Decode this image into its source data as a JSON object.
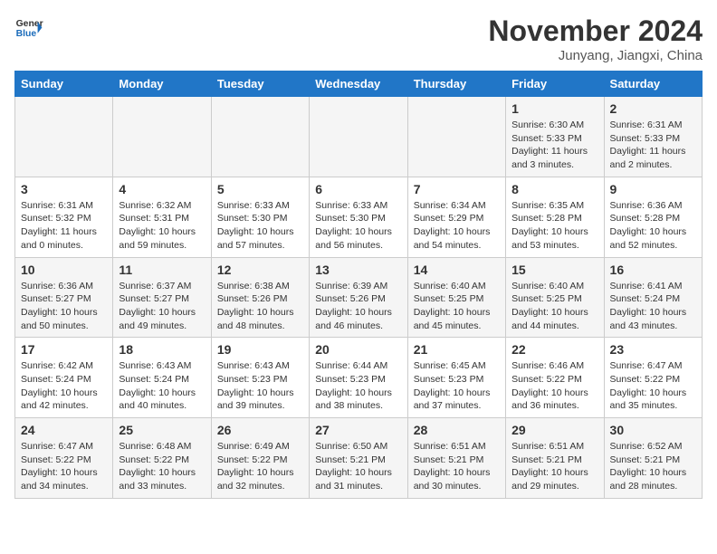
{
  "logo": {
    "general": "General",
    "blue": "Blue"
  },
  "title": "November 2024",
  "location": "Junyang, Jiangxi, China",
  "headers": [
    "Sunday",
    "Monday",
    "Tuesday",
    "Wednesday",
    "Thursday",
    "Friday",
    "Saturday"
  ],
  "weeks": [
    [
      {
        "day": "",
        "text": ""
      },
      {
        "day": "",
        "text": ""
      },
      {
        "day": "",
        "text": ""
      },
      {
        "day": "",
        "text": ""
      },
      {
        "day": "",
        "text": ""
      },
      {
        "day": "1",
        "text": "Sunrise: 6:30 AM\nSunset: 5:33 PM\nDaylight: 11 hours and 3 minutes."
      },
      {
        "day": "2",
        "text": "Sunrise: 6:31 AM\nSunset: 5:33 PM\nDaylight: 11 hours and 2 minutes."
      }
    ],
    [
      {
        "day": "3",
        "text": "Sunrise: 6:31 AM\nSunset: 5:32 PM\nDaylight: 11 hours and 0 minutes."
      },
      {
        "day": "4",
        "text": "Sunrise: 6:32 AM\nSunset: 5:31 PM\nDaylight: 10 hours and 59 minutes."
      },
      {
        "day": "5",
        "text": "Sunrise: 6:33 AM\nSunset: 5:30 PM\nDaylight: 10 hours and 57 minutes."
      },
      {
        "day": "6",
        "text": "Sunrise: 6:33 AM\nSunset: 5:30 PM\nDaylight: 10 hours and 56 minutes."
      },
      {
        "day": "7",
        "text": "Sunrise: 6:34 AM\nSunset: 5:29 PM\nDaylight: 10 hours and 54 minutes."
      },
      {
        "day": "8",
        "text": "Sunrise: 6:35 AM\nSunset: 5:28 PM\nDaylight: 10 hours and 53 minutes."
      },
      {
        "day": "9",
        "text": "Sunrise: 6:36 AM\nSunset: 5:28 PM\nDaylight: 10 hours and 52 minutes."
      }
    ],
    [
      {
        "day": "10",
        "text": "Sunrise: 6:36 AM\nSunset: 5:27 PM\nDaylight: 10 hours and 50 minutes."
      },
      {
        "day": "11",
        "text": "Sunrise: 6:37 AM\nSunset: 5:27 PM\nDaylight: 10 hours and 49 minutes."
      },
      {
        "day": "12",
        "text": "Sunrise: 6:38 AM\nSunset: 5:26 PM\nDaylight: 10 hours and 48 minutes."
      },
      {
        "day": "13",
        "text": "Sunrise: 6:39 AM\nSunset: 5:26 PM\nDaylight: 10 hours and 46 minutes."
      },
      {
        "day": "14",
        "text": "Sunrise: 6:40 AM\nSunset: 5:25 PM\nDaylight: 10 hours and 45 minutes."
      },
      {
        "day": "15",
        "text": "Sunrise: 6:40 AM\nSunset: 5:25 PM\nDaylight: 10 hours and 44 minutes."
      },
      {
        "day": "16",
        "text": "Sunrise: 6:41 AM\nSunset: 5:24 PM\nDaylight: 10 hours and 43 minutes."
      }
    ],
    [
      {
        "day": "17",
        "text": "Sunrise: 6:42 AM\nSunset: 5:24 PM\nDaylight: 10 hours and 42 minutes."
      },
      {
        "day": "18",
        "text": "Sunrise: 6:43 AM\nSunset: 5:24 PM\nDaylight: 10 hours and 40 minutes."
      },
      {
        "day": "19",
        "text": "Sunrise: 6:43 AM\nSunset: 5:23 PM\nDaylight: 10 hours and 39 minutes."
      },
      {
        "day": "20",
        "text": "Sunrise: 6:44 AM\nSunset: 5:23 PM\nDaylight: 10 hours and 38 minutes."
      },
      {
        "day": "21",
        "text": "Sunrise: 6:45 AM\nSunset: 5:23 PM\nDaylight: 10 hours and 37 minutes."
      },
      {
        "day": "22",
        "text": "Sunrise: 6:46 AM\nSunset: 5:22 PM\nDaylight: 10 hours and 36 minutes."
      },
      {
        "day": "23",
        "text": "Sunrise: 6:47 AM\nSunset: 5:22 PM\nDaylight: 10 hours and 35 minutes."
      }
    ],
    [
      {
        "day": "24",
        "text": "Sunrise: 6:47 AM\nSunset: 5:22 PM\nDaylight: 10 hours and 34 minutes."
      },
      {
        "day": "25",
        "text": "Sunrise: 6:48 AM\nSunset: 5:22 PM\nDaylight: 10 hours and 33 minutes."
      },
      {
        "day": "26",
        "text": "Sunrise: 6:49 AM\nSunset: 5:22 PM\nDaylight: 10 hours and 32 minutes."
      },
      {
        "day": "27",
        "text": "Sunrise: 6:50 AM\nSunset: 5:21 PM\nDaylight: 10 hours and 31 minutes."
      },
      {
        "day": "28",
        "text": "Sunrise: 6:51 AM\nSunset: 5:21 PM\nDaylight: 10 hours and 30 minutes."
      },
      {
        "day": "29",
        "text": "Sunrise: 6:51 AM\nSunset: 5:21 PM\nDaylight: 10 hours and 29 minutes."
      },
      {
        "day": "30",
        "text": "Sunrise: 6:52 AM\nSunset: 5:21 PM\nDaylight: 10 hours and 28 minutes."
      }
    ]
  ]
}
